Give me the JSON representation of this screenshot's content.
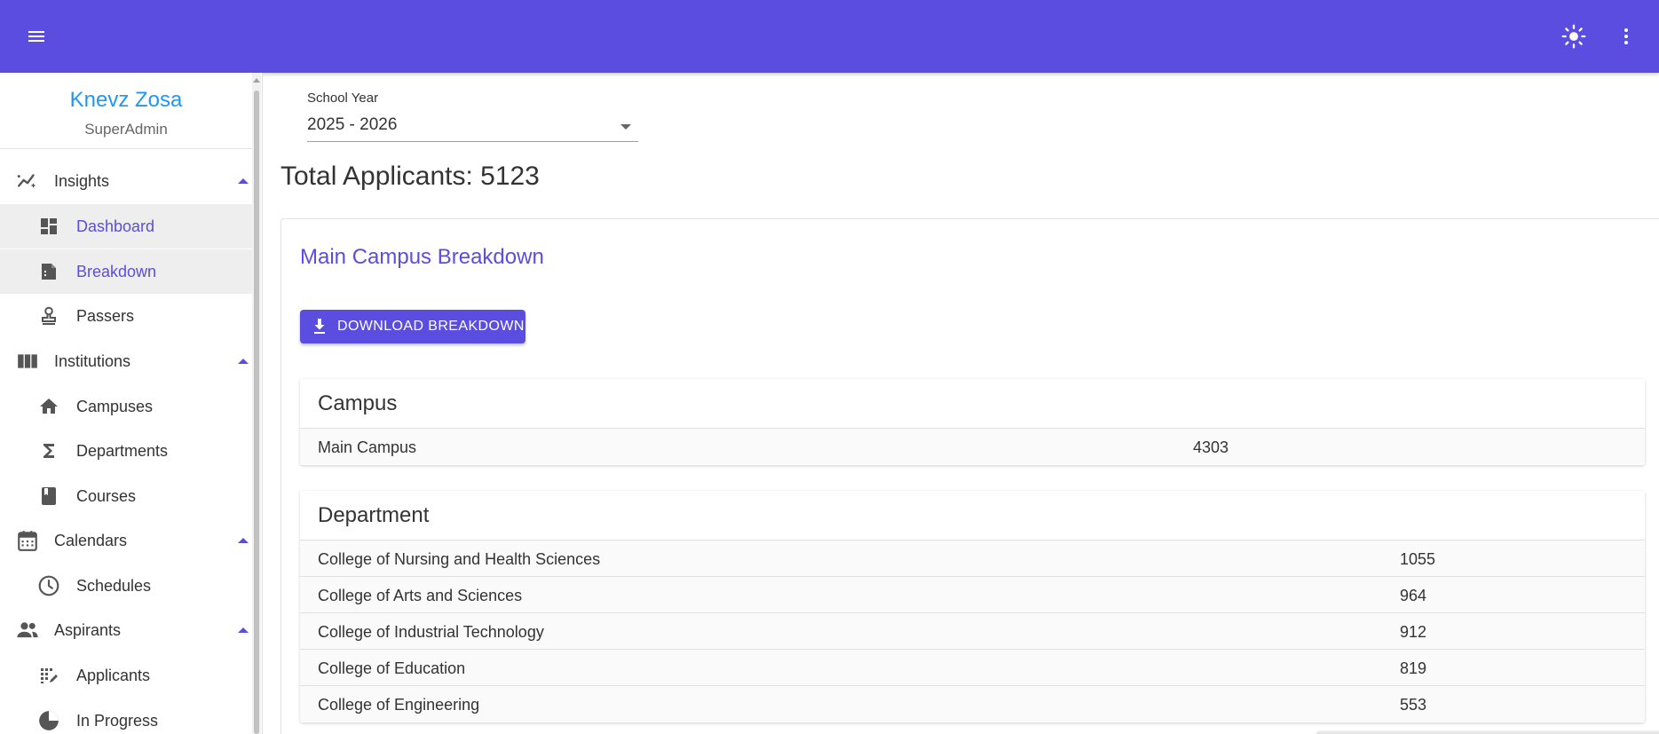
{
  "header": {
    "menu_icon": "menu-icon",
    "theme_icon": "sun-icon",
    "more_icon": "more-vert-icon",
    "bar_color": "#5b4de0"
  },
  "user": {
    "name": "Knevz Zosa",
    "role": "SuperAdmin"
  },
  "sidebar": {
    "groups": [
      {
        "label": "Insights",
        "icon": "insights-icon",
        "items": [
          {
            "label": "Dashboard",
            "icon": "dashboard-icon",
            "active": true
          },
          {
            "label": "Breakdown",
            "icon": "breakdown-icon",
            "active": true
          },
          {
            "label": "Passers",
            "icon": "stamp-icon",
            "active": false
          }
        ]
      },
      {
        "label": "Institutions",
        "icon": "columns-icon",
        "items": [
          {
            "label": "Campuses",
            "icon": "home-icon"
          },
          {
            "label": "Departments",
            "icon": "sigma-icon"
          },
          {
            "label": "Courses",
            "icon": "book-icon"
          }
        ]
      },
      {
        "label": "Calendars",
        "icon": "calendar-icon",
        "items": [
          {
            "label": "Schedules",
            "icon": "clock-icon"
          }
        ]
      },
      {
        "label": "Aspirants",
        "icon": "people-icon",
        "items": [
          {
            "label": "Applicants",
            "icon": "applicants-icon"
          },
          {
            "label": "In Progress",
            "icon": "pie-icon"
          }
        ]
      }
    ]
  },
  "filters": {
    "school_year_label": "School Year",
    "school_year_value": "2025 - 2026"
  },
  "summary": {
    "total_applicants": "Total Applicants: 5123"
  },
  "breakdown": {
    "title": "Main Campus Breakdown",
    "download_label": "DOWNLOAD BREAKDOWN",
    "campus": {
      "title": "Campus",
      "rows": [
        {
          "name": "Main Campus",
          "count": "4303"
        }
      ]
    },
    "department": {
      "title": "Department",
      "rows": [
        {
          "name": "College of Nursing and Health Sciences",
          "count": "1055"
        },
        {
          "name": "College of Arts and Sciences",
          "count": "964"
        },
        {
          "name": "College of Industrial Technology",
          "count": "912"
        },
        {
          "name": "College of Education",
          "count": "819"
        },
        {
          "name": "College of Engineering",
          "count": "553"
        }
      ]
    }
  }
}
